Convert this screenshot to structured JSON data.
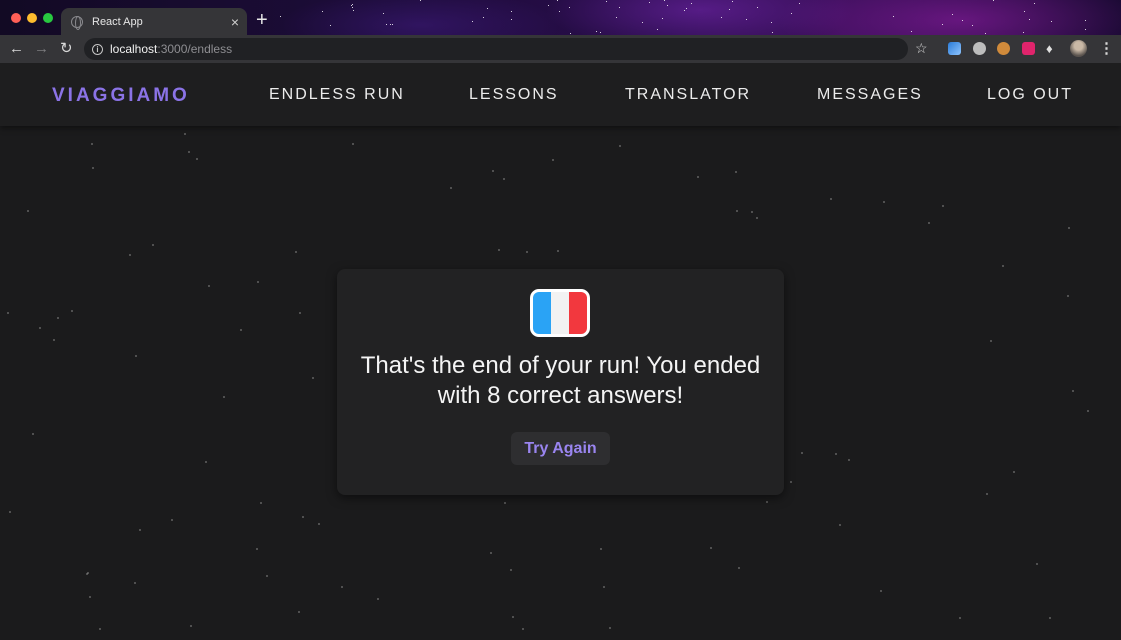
{
  "browser": {
    "tab_title": "React App",
    "tab_close": "×",
    "new_tab": "+",
    "url_host": "localhost",
    "url_path": ":3000/endless"
  },
  "navbar": {
    "brand": "VIAGGIAMO",
    "links": [
      "ENDLESS RUN",
      "LESSONS",
      "TRANSLATOR",
      "MESSAGES",
      "LOG OUT"
    ]
  },
  "result_card": {
    "flag": "france-flag",
    "message": "That's the end of your run! You ended with 8 correct answers!",
    "button_label": "Try Again"
  },
  "colors": {
    "accent": "#8b73e6",
    "background": "#1b1b1c",
    "card": "#222223"
  }
}
